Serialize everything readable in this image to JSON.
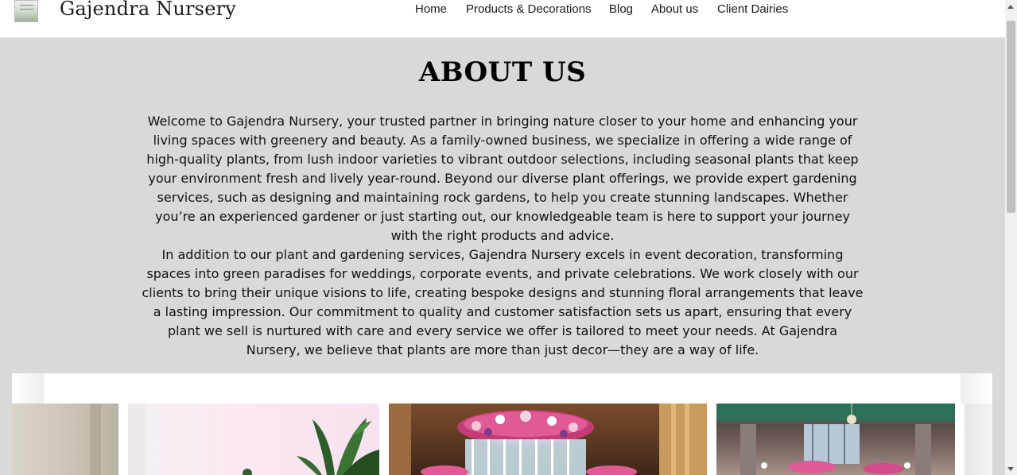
{
  "header": {
    "brand": "Gajendra Nursery",
    "nav": [
      {
        "label": "Home"
      },
      {
        "label": "Products & Decorations"
      },
      {
        "label": "Blog"
      },
      {
        "label": "About us"
      },
      {
        "label": "Client Dairies"
      }
    ]
  },
  "about": {
    "title": "ABOUT US",
    "paragraph_1": "Welcome to Gajendra Nursery, your trusted partner in bringing nature closer to your home and enhancing your living spaces with greenery and beauty. As a family-owned business, we specialize in offering a wide range of high-quality plants, from lush indoor varieties to vibrant outdoor selections, including seasonal plants that keep your environment fresh and lively year-round. Beyond our diverse plant offerings, we provide expert gardening services, such as designing and maintaining rock gardens, to help you create stunning landscapes. Whether you’re an experienced gardener or just starting out, our knowledgeable team is here to support your journey with the right products and advice.",
    "paragraph_2": "In addition to our plant and gardening services, Gajendra Nursery excels in event decoration, transforming spaces into green paradises for weddings, corporate events, and private celebrations. We work closely with our clients to bring their unique visions to life, creating bespoke designs and stunning floral arrangements that leave a lasting impression. Our commitment to quality and customer satisfaction sets us apart, ensuring that every plant we sell is nurtured with care and every service we offer is tailored to meet your needs. At Gajendra Nursery, we believe that plants are more than just decor—they are a way of life."
  },
  "colors": {
    "page_background": "#d9d9d9",
    "navbar_background": "#ffffff",
    "text": "#111111",
    "flower_pink": "#e05a95",
    "plant_green": "#2f5d2a"
  },
  "icons": [
    "scroll-up-arrow-icon",
    "scroll-down-arrow-icon"
  ]
}
